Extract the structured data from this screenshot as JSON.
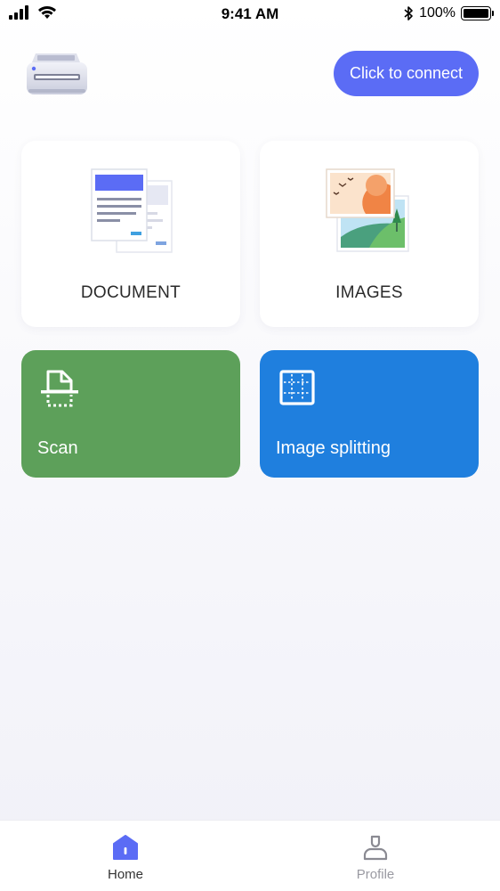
{
  "status_bar": {
    "time": "9:41 AM",
    "battery": "100%",
    "icons": [
      "signal-icon",
      "wifi-icon",
      "bluetooth-icon",
      "battery-icon"
    ]
  },
  "header": {
    "printer_icon": "printer-icon",
    "connect_label": "Click to connect",
    "connect_color": "#5b6cf5"
  },
  "cards": {
    "document": {
      "label": "DOCUMENT",
      "icon": "document-icon"
    },
    "images": {
      "label": "IMAGES",
      "icon": "images-icon"
    },
    "scan": {
      "label": "Scan",
      "icon": "scan-icon",
      "color": "#5da05a"
    },
    "image_splitting": {
      "label": "Image splitting",
      "icon": "grid-split-icon",
      "color": "#1f7fde"
    }
  },
  "tabbar": {
    "items": [
      {
        "label": "Home",
        "icon": "home-icon",
        "active": true
      },
      {
        "label": "Profile",
        "icon": "profile-icon",
        "active": false
      }
    ]
  }
}
